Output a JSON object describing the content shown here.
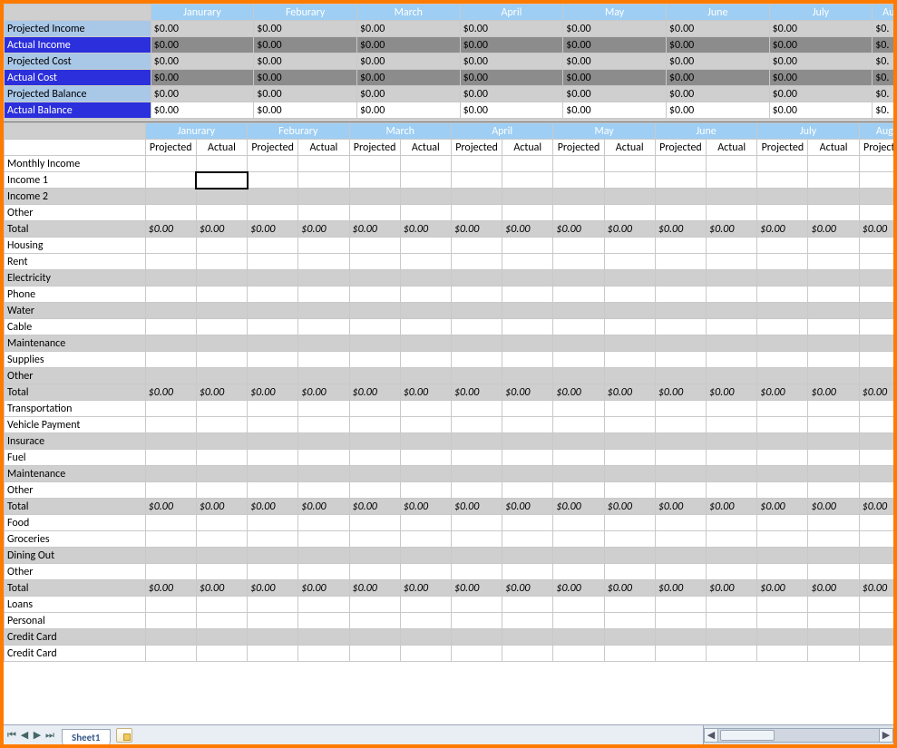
{
  "tabs": {
    "active": "Sheet1"
  },
  "months": [
    "Janurary",
    "Feburary",
    "March",
    "April",
    "May",
    "June",
    "July",
    "Aug"
  ],
  "summary_rows": [
    {
      "label": "Projected Income",
      "style": "row-lblue",
      "val_style": "row-gray",
      "values": [
        "$0.00",
        "$0.00",
        "$0.00",
        "$0.00",
        "$0.00",
        "$0.00",
        "$0.00",
        "$0."
      ]
    },
    {
      "label": "Actual Income",
      "style": "row-dblue",
      "val_style": "row-dgray",
      "values": [
        "$0.00",
        "$0.00",
        "$0.00",
        "$0.00",
        "$0.00",
        "$0.00",
        "$0.00",
        "$0."
      ]
    },
    {
      "label": "Projected Cost",
      "style": "row-lblue",
      "val_style": "row-gray",
      "values": [
        "$0.00",
        "$0.00",
        "$0.00",
        "$0.00",
        "$0.00",
        "$0.00",
        "$0.00",
        "$0."
      ]
    },
    {
      "label": "Actual Cost",
      "style": "row-dblue",
      "val_style": "row-dgray",
      "values": [
        "$0.00",
        "$0.00",
        "$0.00",
        "$0.00",
        "$0.00",
        "$0.00",
        "$0.00",
        "$0."
      ]
    },
    {
      "label": "Projected Balance",
      "style": "row-lblue",
      "val_style": "row-gray",
      "values": [
        "$0.00",
        "$0.00",
        "$0.00",
        "$0.00",
        "$0.00",
        "$0.00",
        "$0.00",
        "$0."
      ]
    },
    {
      "label": "Actual Balance",
      "style": "row-dblue",
      "val_style": "row-white",
      "values": [
        "$0.00",
        "$0.00",
        "$0.00",
        "$0.00",
        "$0.00",
        "$0.00",
        "$0.00",
        "$0."
      ]
    }
  ],
  "sub_headers": [
    "Projected",
    "Actual"
  ],
  "sections": [
    {
      "title": "Monthly Income",
      "rows": [
        {
          "label": "Income 1",
          "style": "row-white",
          "selected_col": 1
        },
        {
          "label": "Income 2",
          "style": "row-gray"
        },
        {
          "label": "Other",
          "style": "row-white"
        }
      ],
      "total": {
        "label": "Total",
        "values15": [
          "$0.00",
          "$0.00",
          "$0.00",
          "$0.00",
          "$0.00",
          "$0.00",
          "$0.00",
          "$0.00",
          "$0.00",
          "$0.00",
          "$0.00",
          "$0.00",
          "$0.00",
          "$0.00",
          "$0.00"
        ]
      }
    },
    {
      "title": "Housing",
      "rows": [
        {
          "label": "Rent",
          "style": "row-white"
        },
        {
          "label": "Electricity",
          "style": "row-gray"
        },
        {
          "label": "Phone",
          "style": "row-white"
        },
        {
          "label": "Water",
          "style": "row-gray"
        },
        {
          "label": "Cable",
          "style": "row-white"
        },
        {
          "label": "Maintenance",
          "style": "row-gray"
        },
        {
          "label": "Supplies",
          "style": "row-white"
        },
        {
          "label": "Other",
          "style": "row-gray"
        }
      ],
      "total": {
        "label": "Total",
        "values15": [
          "$0.00",
          "$0.00",
          "$0.00",
          "$0.00",
          "$0.00",
          "$0.00",
          "$0.00",
          "$0.00",
          "$0.00",
          "$0.00",
          "$0.00",
          "$0.00",
          "$0.00",
          "$0.00",
          "$0.00"
        ]
      }
    },
    {
      "title": "Transportation",
      "rows": [
        {
          "label": "Vehicle Payment",
          "style": "row-white"
        },
        {
          "label": "Insurace",
          "style": "row-gray"
        },
        {
          "label": "Fuel",
          "style": "row-white"
        },
        {
          "label": "Maintenance",
          "style": "row-gray"
        },
        {
          "label": "Other",
          "style": "row-white"
        }
      ],
      "total": {
        "label": "Total",
        "values15": [
          "$0.00",
          "$0.00",
          "$0.00",
          "$0.00",
          "$0.00",
          "$0.00",
          "$0.00",
          "$0.00",
          "$0.00",
          "$0.00",
          "$0.00",
          "$0.00",
          "$0.00",
          "$0.00",
          "$0.00"
        ]
      }
    },
    {
      "title": "Food",
      "rows": [
        {
          "label": "Groceries",
          "style": "row-white"
        },
        {
          "label": "Dining Out",
          "style": "row-gray"
        },
        {
          "label": "Other",
          "style": "row-white"
        }
      ],
      "total": {
        "label": "Total",
        "values15": [
          "$0.00",
          "$0.00",
          "$0.00",
          "$0.00",
          "$0.00",
          "$0.00",
          "$0.00",
          "$0.00",
          "$0.00",
          "$0.00",
          "$0.00",
          "$0.00",
          "$0.00",
          "$0.00",
          "$0.00"
        ]
      }
    },
    {
      "title": "Loans",
      "rows": [
        {
          "label": "Personal",
          "style": "row-white"
        },
        {
          "label": "Credit Card",
          "style": "row-gray"
        },
        {
          "label": "Credit Card",
          "style": "row-white"
        }
      ]
    }
  ]
}
